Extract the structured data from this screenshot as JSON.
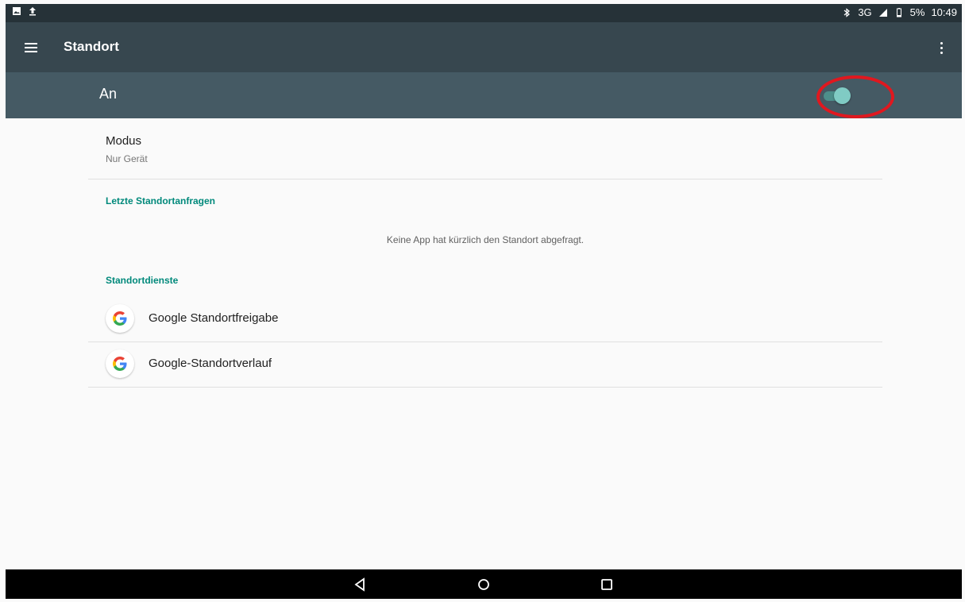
{
  "status_bar": {
    "left_icons": [
      "image-notification-icon",
      "upload-icon"
    ],
    "right": {
      "bluetooth_icon": "bluetooth-icon",
      "network": "3G",
      "signal_icon": "signal-icon",
      "battery_icon": "battery-icon",
      "battery": "5%",
      "time": "10:49"
    }
  },
  "toolbar": {
    "menu_icon": "menu-icon",
    "title": "Standort",
    "more_icon": "more-vert-icon"
  },
  "master_switch": {
    "label": "An",
    "state": "on",
    "annotation_color": "#e0181f"
  },
  "modus": {
    "title": "Modus",
    "value": "Nur Gerät"
  },
  "recent_requests": {
    "header": "Letzte Standortanfragen",
    "empty_message": "Keine App hat kürzlich den Standort abgefragt."
  },
  "location_services": {
    "header": "Standortdienste",
    "items": [
      {
        "label": "Google Standortfreigabe",
        "icon": "google-icon"
      },
      {
        "label": "Google-Standortverlauf",
        "icon": "google-icon"
      }
    ]
  },
  "colors": {
    "status_bar": "#263238",
    "toolbar": "#37474f",
    "switch_bar": "#455a64",
    "accent": "#00897b",
    "toggle_thumb": "#80cbc4"
  },
  "nav_bar": [
    "back-icon",
    "home-icon",
    "recents-icon"
  ]
}
